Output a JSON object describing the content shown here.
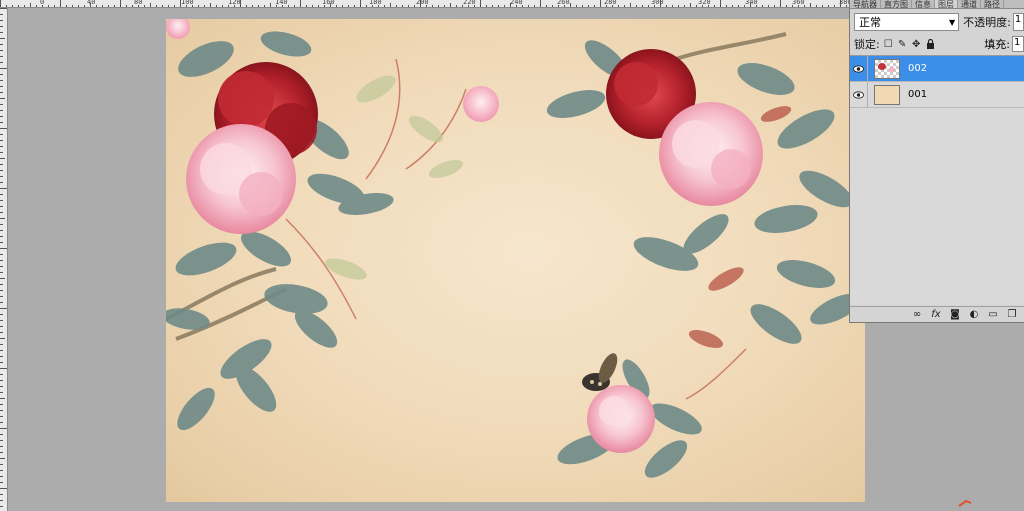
{
  "ruler": {
    "numbers": [
      "0",
      "40",
      "80",
      "100",
      "120",
      "140",
      "160",
      "180",
      "200",
      "220",
      "240",
      "260",
      "280",
      "300",
      "320",
      "340",
      "360",
      "380",
      "400",
      "420"
    ]
  },
  "panel": {
    "tabs": [
      "导航器",
      "直方图",
      "信息",
      "图层",
      "通道",
      "路径"
    ],
    "blend_mode": "正常",
    "opacity_label": "不透明度:",
    "opacity_value": "1",
    "lock_label": "锁定:",
    "fill_label": "填充:",
    "fill_value": "1",
    "layers": [
      {
        "name": "002",
        "selected": true
      },
      {
        "name": "001",
        "selected": false
      }
    ],
    "bottom_icons": [
      "link-icon",
      "fx-icon",
      "mask-icon",
      "adjustment-icon",
      "group-icon",
      "new-layer-icon"
    ]
  },
  "colors": {
    "selected_layer": "#3c8fe8",
    "canvas_bg": "#f1dcbc",
    "peony_red": "#b5222c",
    "peony_pink": "#f5bccb",
    "leaf": "#6f8a88"
  }
}
